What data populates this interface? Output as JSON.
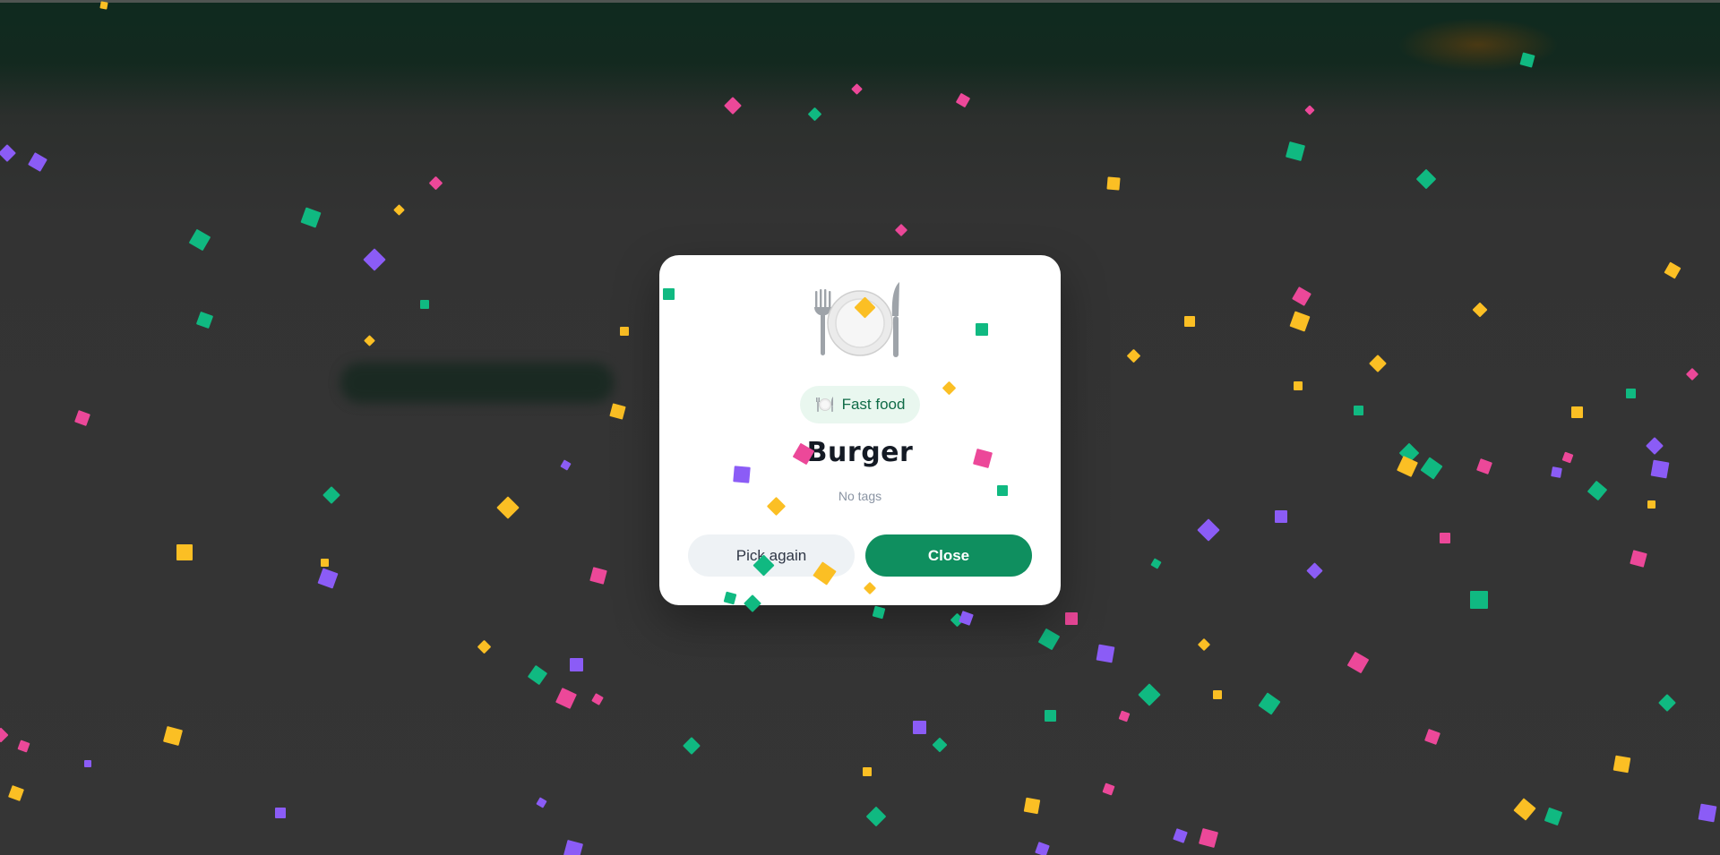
{
  "result_dialog": {
    "dish_icon": "plate-with-cutlery-icon",
    "category": {
      "icon": "plate-with-cutlery-icon",
      "label": "Fast food"
    },
    "dish_name": "Burger",
    "tags_text": "No tags",
    "buttons": {
      "pick_again_label": "Pick again",
      "close_label": "Close"
    }
  },
  "colors": {
    "accent": "#0f8f5f",
    "chip_background": "#e9f7ef",
    "chip_text": "#0f6b47",
    "overlay": "#363636",
    "confetti": [
      "#10b981",
      "#ec4899",
      "#fbbf24",
      "#8b5cf6"
    ]
  }
}
